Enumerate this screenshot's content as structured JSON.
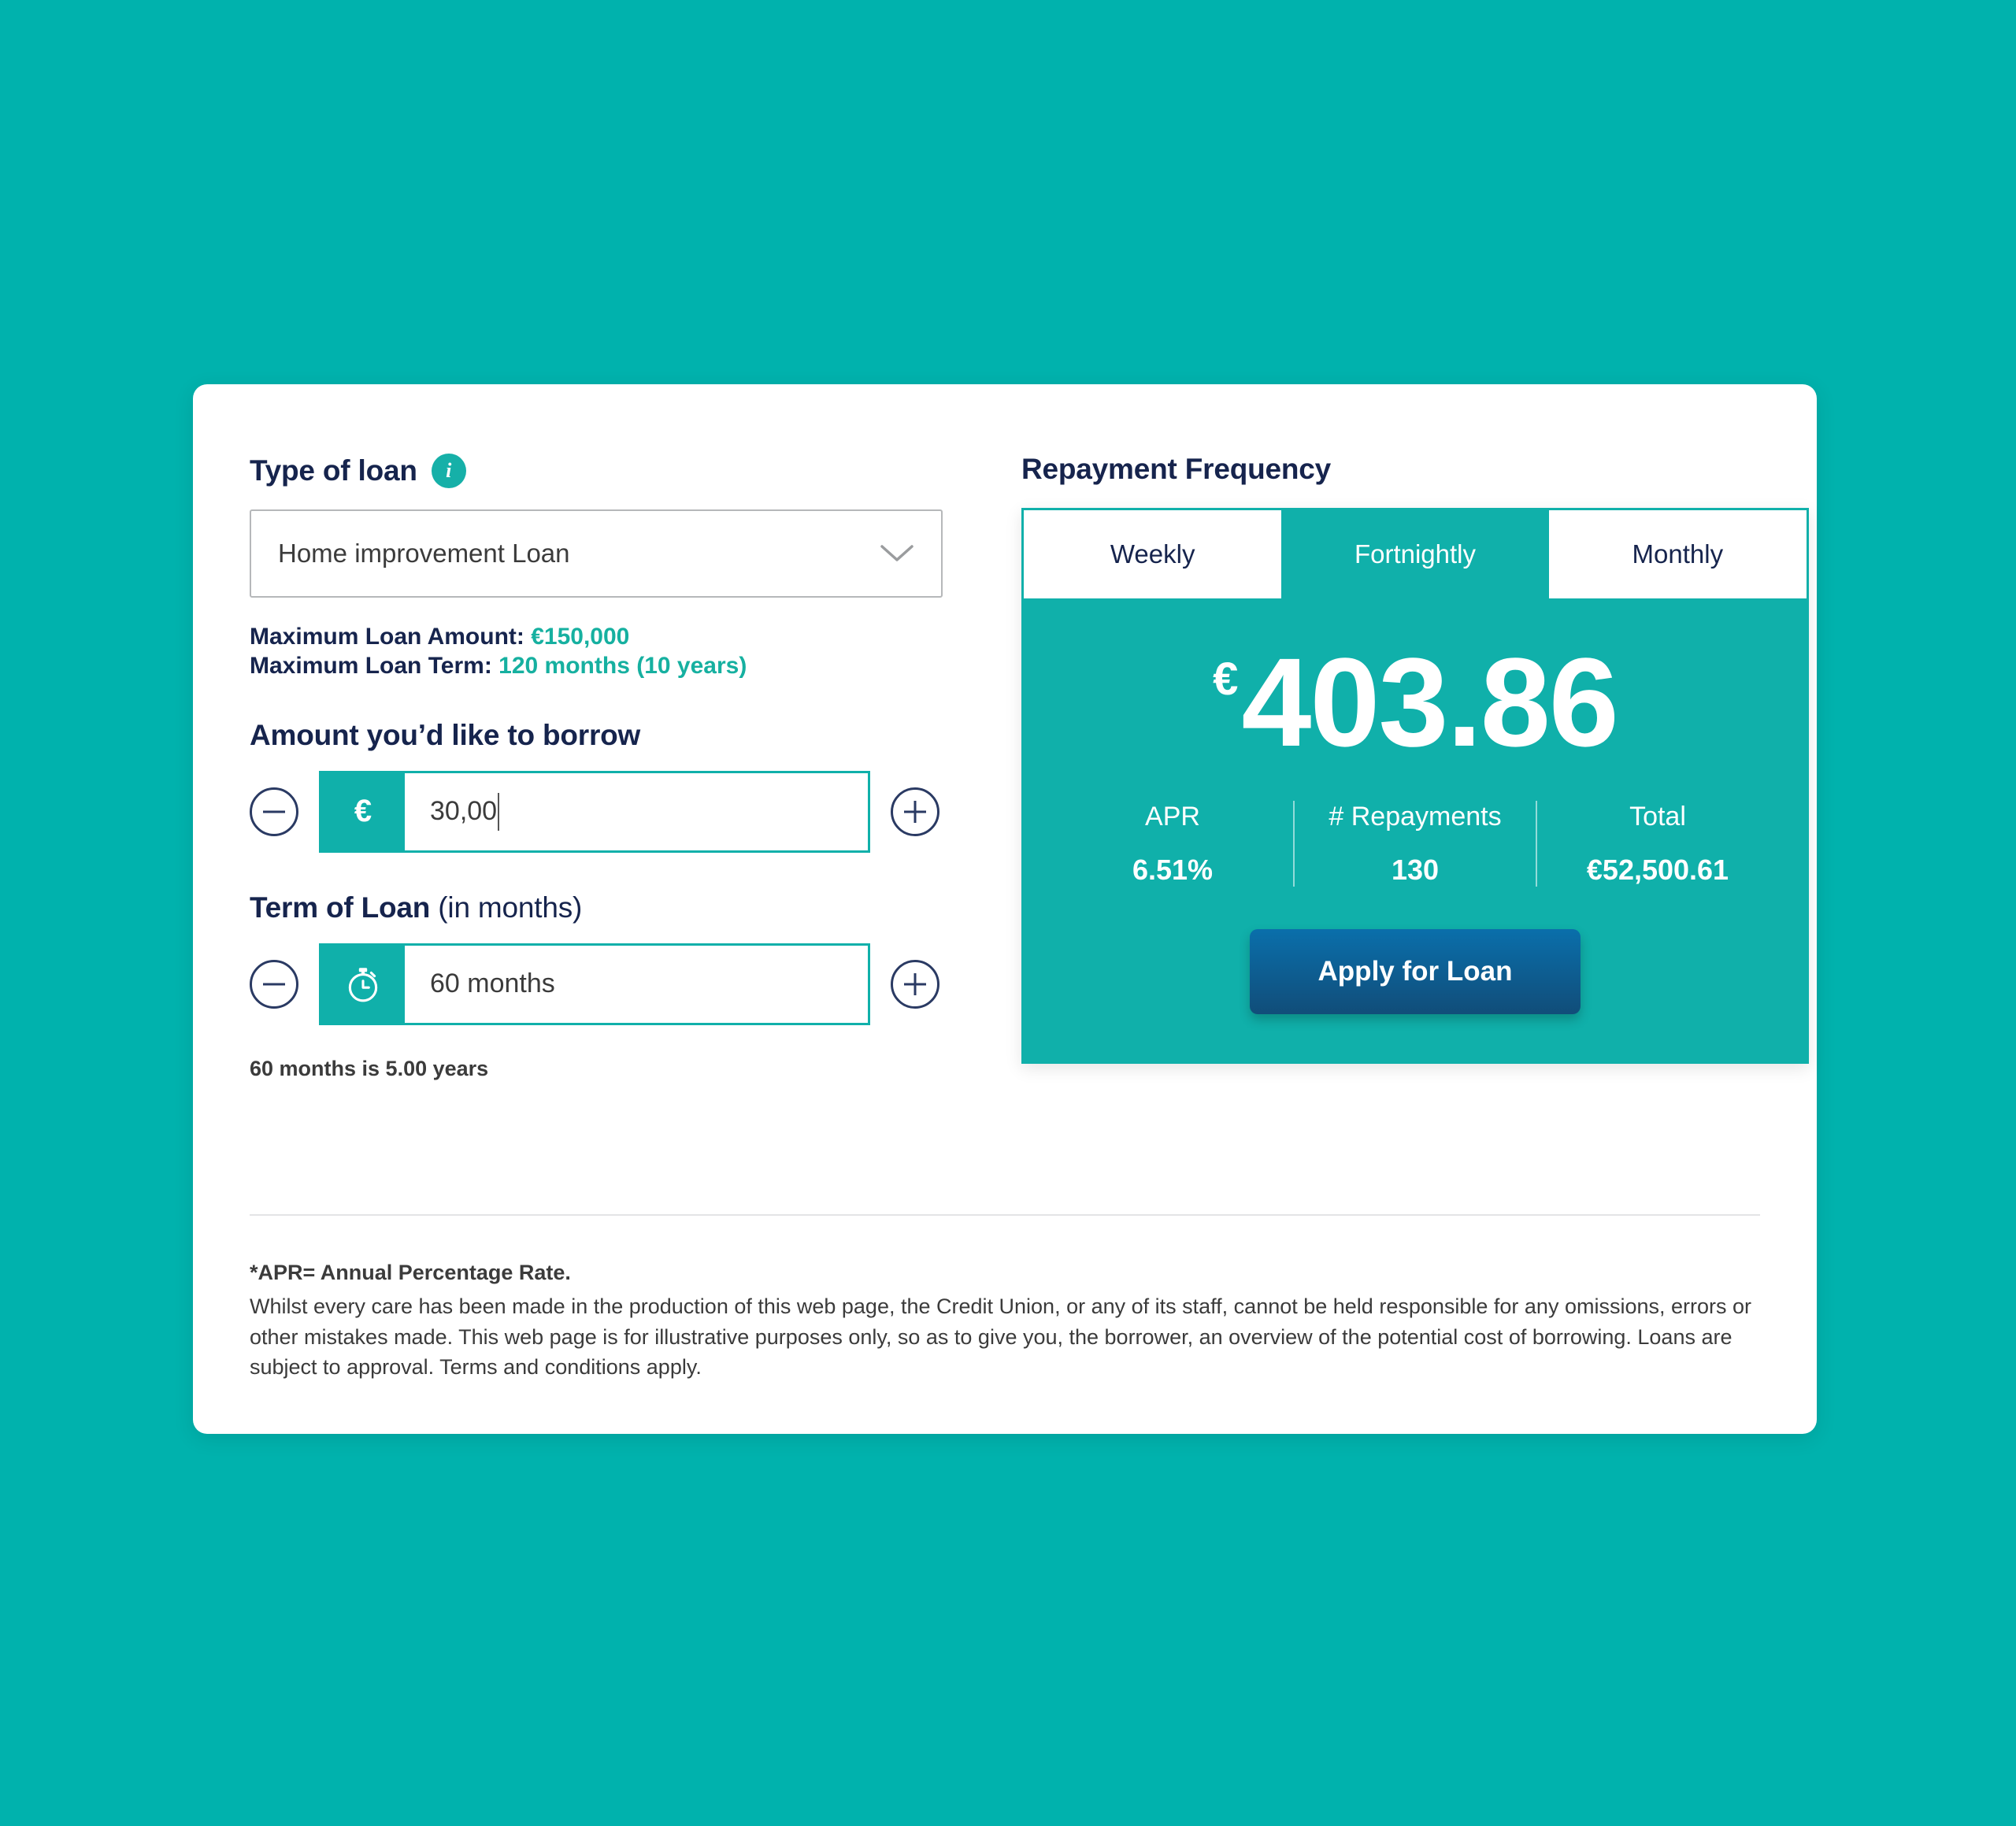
{
  "loan_type": {
    "label": "Type of loan",
    "info_icon": "info-icon",
    "selected": "Home improvement Loan",
    "chevron": "chevron-down-icon"
  },
  "max_info": {
    "amount_label": "Maximum Loan Amount:",
    "amount_value": "€150,000",
    "term_label": "Maximum Loan Term:",
    "term_value": "120 months (10 years)"
  },
  "amount": {
    "title": "Amount you’d like to borrow",
    "decrement": "minus-icon",
    "increment": "plus-icon",
    "currency_symbol": "€",
    "value": "30,00"
  },
  "term": {
    "title_strong": "Term of Loan",
    "title_light": "(in months)",
    "decrement": "minus-icon",
    "increment": "plus-icon",
    "prefix_icon": "stopwatch-icon",
    "value": "60 months",
    "hint": "60 months is 5.00 years"
  },
  "repayment": {
    "title": "Repayment Frequency",
    "tabs": [
      {
        "label": "Weekly",
        "active": false
      },
      {
        "label": "Fortnightly",
        "active": true
      },
      {
        "label": "Monthly",
        "active": false
      }
    ],
    "currency_symbol": "€",
    "amount": "403.86",
    "stats": [
      {
        "key": "APR",
        "value": "6.51%"
      },
      {
        "key": "# Repayments",
        "value": "130"
      },
      {
        "key": "Total",
        "value": "€52,500.61"
      }
    ],
    "apply_label": "Apply for Loan"
  },
  "footer": {
    "apr_note": "*APR= Annual Percentage Rate.",
    "disclaimer": "Whilst every care has been made in the production of this web page, the Credit Union, or any of its staff, cannot be held responsible for any omissions, errors or other mistakes made. This web page is for illustrative purposes only, so as to give you, the borrower, an overview of the potential cost of borrowing. Loans are subject to approval. Terms and conditions apply."
  },
  "colors": {
    "background_teal": "#00b2ad",
    "panel_teal": "#10b0aa",
    "navy": "#16244d",
    "accent_green": "#16b0a0",
    "apply_button_top": "#0a6fab",
    "apply_button_bottom": "#114d79"
  }
}
